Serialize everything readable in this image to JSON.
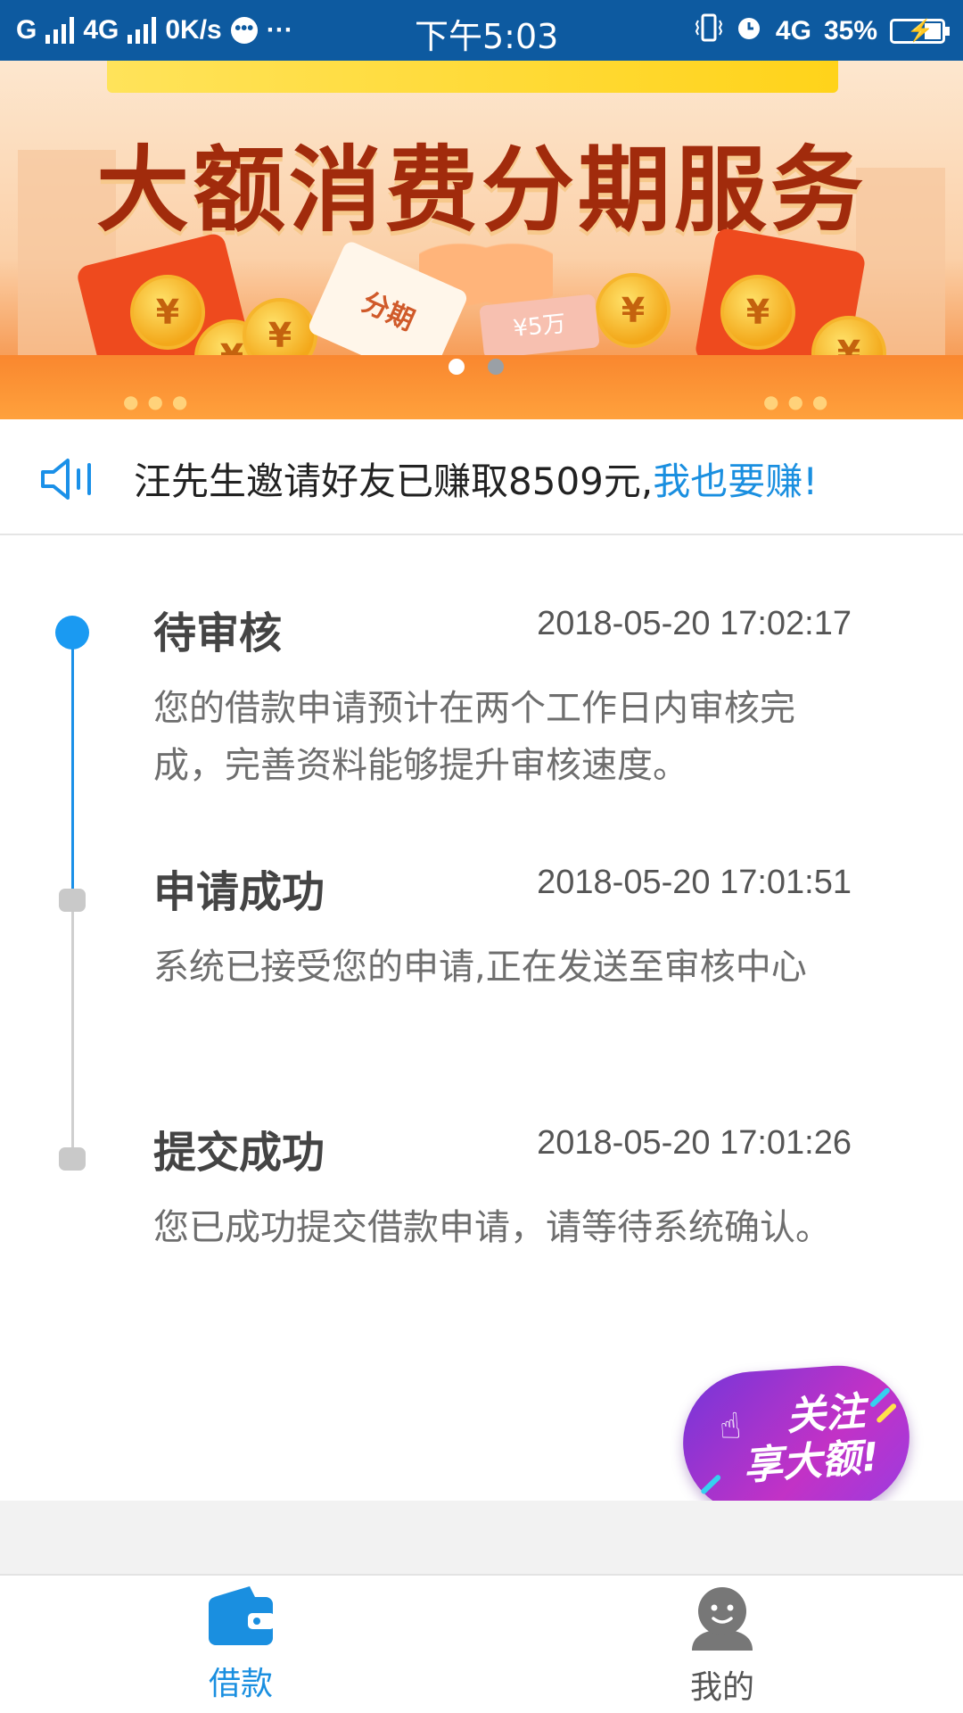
{
  "status_bar": {
    "carrier1": "G",
    "carrier2": "4G",
    "speed": "0K/s",
    "more": "···",
    "time": "下午5:03",
    "network": "4G",
    "battery": "35%"
  },
  "banner": {
    "headline": "大额消费分期服务",
    "ticket_label": "分期",
    "voucher_label": "¥5万",
    "coin_symbol": "¥",
    "page_count": 2,
    "active_page": 1
  },
  "notice": {
    "text": "汪先生邀请好友已赚取8509元,",
    "link": "我也要赚!"
  },
  "timeline": {
    "items": [
      {
        "title": "待审核",
        "time": "2018-05-20 17:02:17",
        "desc": "您的借款申请预计在两个工作日内审核完成，完善资料能够提升审核速度。",
        "state": "active"
      },
      {
        "title": "申请成功",
        "time": "2018-05-20 17:01:51",
        "desc": "系统已接受您的申请,正在发送至审核中心",
        "state": "done"
      },
      {
        "title": "提交成功",
        "time": "2018-05-20 17:01:26",
        "desc": "您已成功提交借款申请，请等待系统确认。",
        "state": "done"
      }
    ]
  },
  "follow_button": {
    "line1": "关注",
    "line2": "享大额!"
  },
  "bottom_nav": {
    "items": [
      {
        "label": "借款",
        "icon": "wallet-icon",
        "active": true
      },
      {
        "label": "我的",
        "icon": "user-avatar-icon",
        "active": false
      }
    ]
  },
  "colors": {
    "accent": "#1a8fe0",
    "status_bar": "#0d5aa0",
    "timeline_active": "#1a9af2",
    "timeline_inactive": "#c9c9c9"
  }
}
